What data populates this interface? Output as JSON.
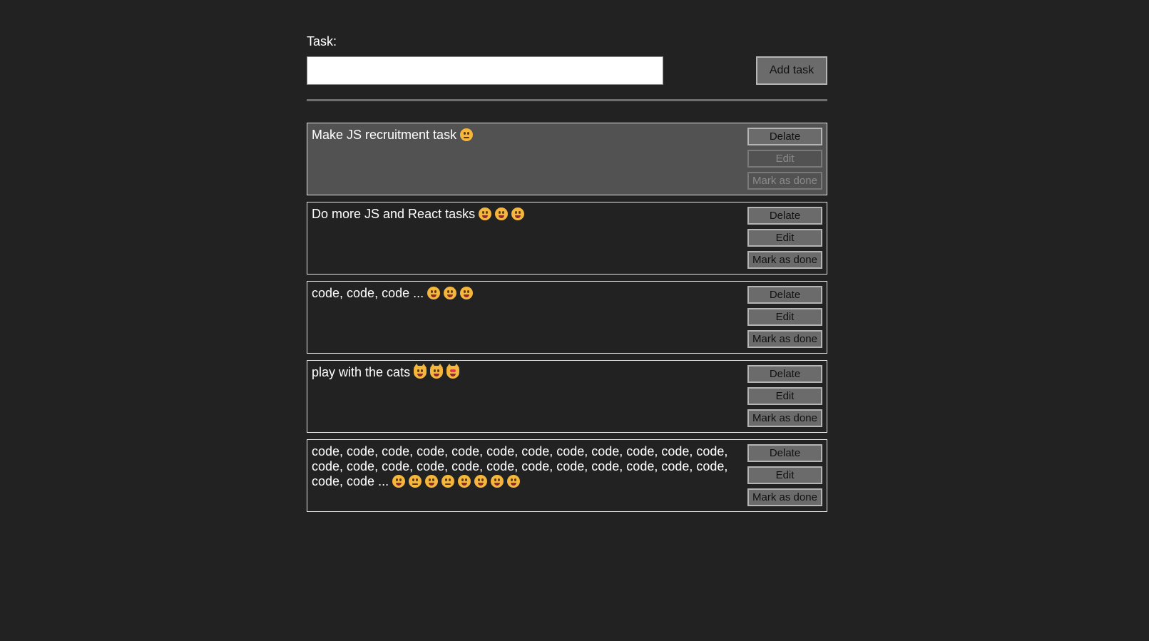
{
  "form": {
    "label": "Task:",
    "input_value": "",
    "add_button_label": "Add task"
  },
  "tasks": [
    {
      "text": "Make JS recruitment task",
      "emojis": [
        "neutral-face-icon"
      ],
      "editing": true,
      "delete_label": "Delate",
      "edit_label": "Edit",
      "done_label": "Mark as done"
    },
    {
      "text": "Do more JS and React tasks",
      "emojis": [
        "smiling-face-icon",
        "smiling-face-icon",
        "smiling-face-icon"
      ],
      "editing": false,
      "delete_label": "Delate",
      "edit_label": "Edit",
      "done_label": "Mark as done"
    },
    {
      "text": "code, code, code ...",
      "emojis": [
        "grinning-face-icon",
        "grinning-face-icon",
        "grinning-face-icon"
      ],
      "editing": false,
      "delete_label": "Delate",
      "edit_label": "Edit",
      "done_label": "Mark as done"
    },
    {
      "text": "play with the cats",
      "emojis": [
        "cat-face-icon",
        "cat-face-icon",
        "heart-eyes-cat-icon"
      ],
      "editing": false,
      "delete_label": "Delate",
      "edit_label": "Edit",
      "done_label": "Mark as done"
    },
    {
      "text": "code, code, code, code, code, code, code, code, code, code, code, code, code, code, code, code, code, code, code, code, code, code, code, code, code, code ...",
      "emojis": [
        "grinning-face-icon",
        "blank-face-icon",
        "upside-down-face-icon",
        "eye-roll-face-icon",
        "dizzy-face-icon",
        "grinning-face-icon",
        "grin-face-icon",
        "sweat-smile-face-icon"
      ],
      "editing": false,
      "delete_label": "Delate",
      "edit_label": "Edit",
      "done_label": "Mark as done"
    }
  ],
  "colors": {
    "background": "#222222",
    "button_bg": "#6b6b6b",
    "editing_bg": "#525252",
    "emoji_yellow": "#f4b63d"
  }
}
